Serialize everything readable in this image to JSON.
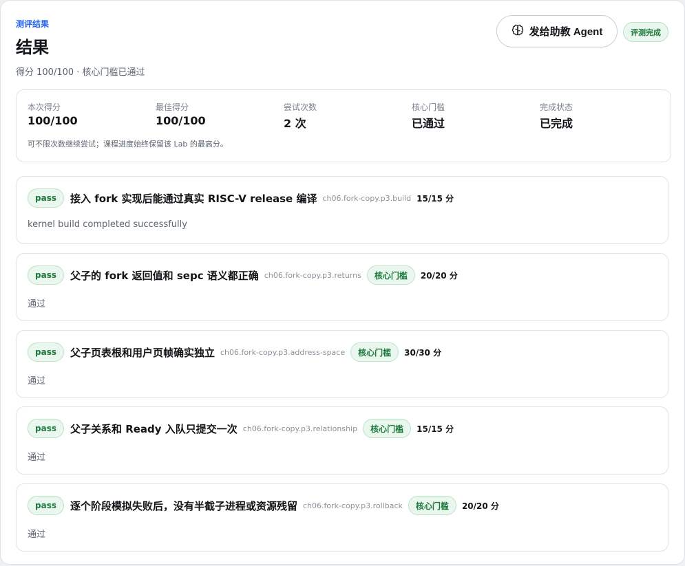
{
  "header": {
    "eyebrow": "测评结果",
    "title": "结果",
    "subtitle": "得分 100/100 · 核心门槛已通过",
    "agent_button_label": "发给助教 Agent",
    "status_badge": "评测完成"
  },
  "summary": {
    "stats": [
      {
        "label": "本次得分",
        "value": "100/100"
      },
      {
        "label": "最佳得分",
        "value": "100/100"
      },
      {
        "label": "尝试次数",
        "value": "2 次"
      },
      {
        "label": "核心门槛",
        "value": "已通过"
      },
      {
        "label": "完成状态",
        "value": "已完成"
      }
    ],
    "note": "可不限次数继续尝试；课程进度始终保留该 Lab 的最高分。"
  },
  "checks": [
    {
      "status": "pass",
      "title": "接入 fork 实现后能通过真实 RISC-V release 编译",
      "id": "ch06.fork-copy.p3.build",
      "core": "",
      "score": "15/15 分",
      "detail": "kernel build completed successfully"
    },
    {
      "status": "pass",
      "title": "父子的 fork 返回值和 sepc 语义都正确",
      "id": "ch06.fork-copy.p3.returns",
      "core": "核心门槛",
      "score": "20/20 分",
      "detail": "通过"
    },
    {
      "status": "pass",
      "title": "父子页表根和用户页帧确实独立",
      "id": "ch06.fork-copy.p3.address-space",
      "core": "核心门槛",
      "score": "30/30 分",
      "detail": "通过"
    },
    {
      "status": "pass",
      "title": "父子关系和 Ready 入队只提交一次",
      "id": "ch06.fork-copy.p3.relationship",
      "core": "核心门槛",
      "score": "15/15 分",
      "detail": "通过"
    },
    {
      "status": "pass",
      "title": "逐个阶段模拟失败后，没有半截子进程或资源残留",
      "id": "ch06.fork-copy.p3.rollback",
      "core": "核心门槛",
      "score": "20/20 分",
      "detail": "通过"
    }
  ],
  "icons": {
    "agent_button": "brain-icon"
  },
  "colors": {
    "accent": "#2563eb",
    "success_text": "#1e7a3d",
    "success_bg": "#eaf7ee"
  }
}
